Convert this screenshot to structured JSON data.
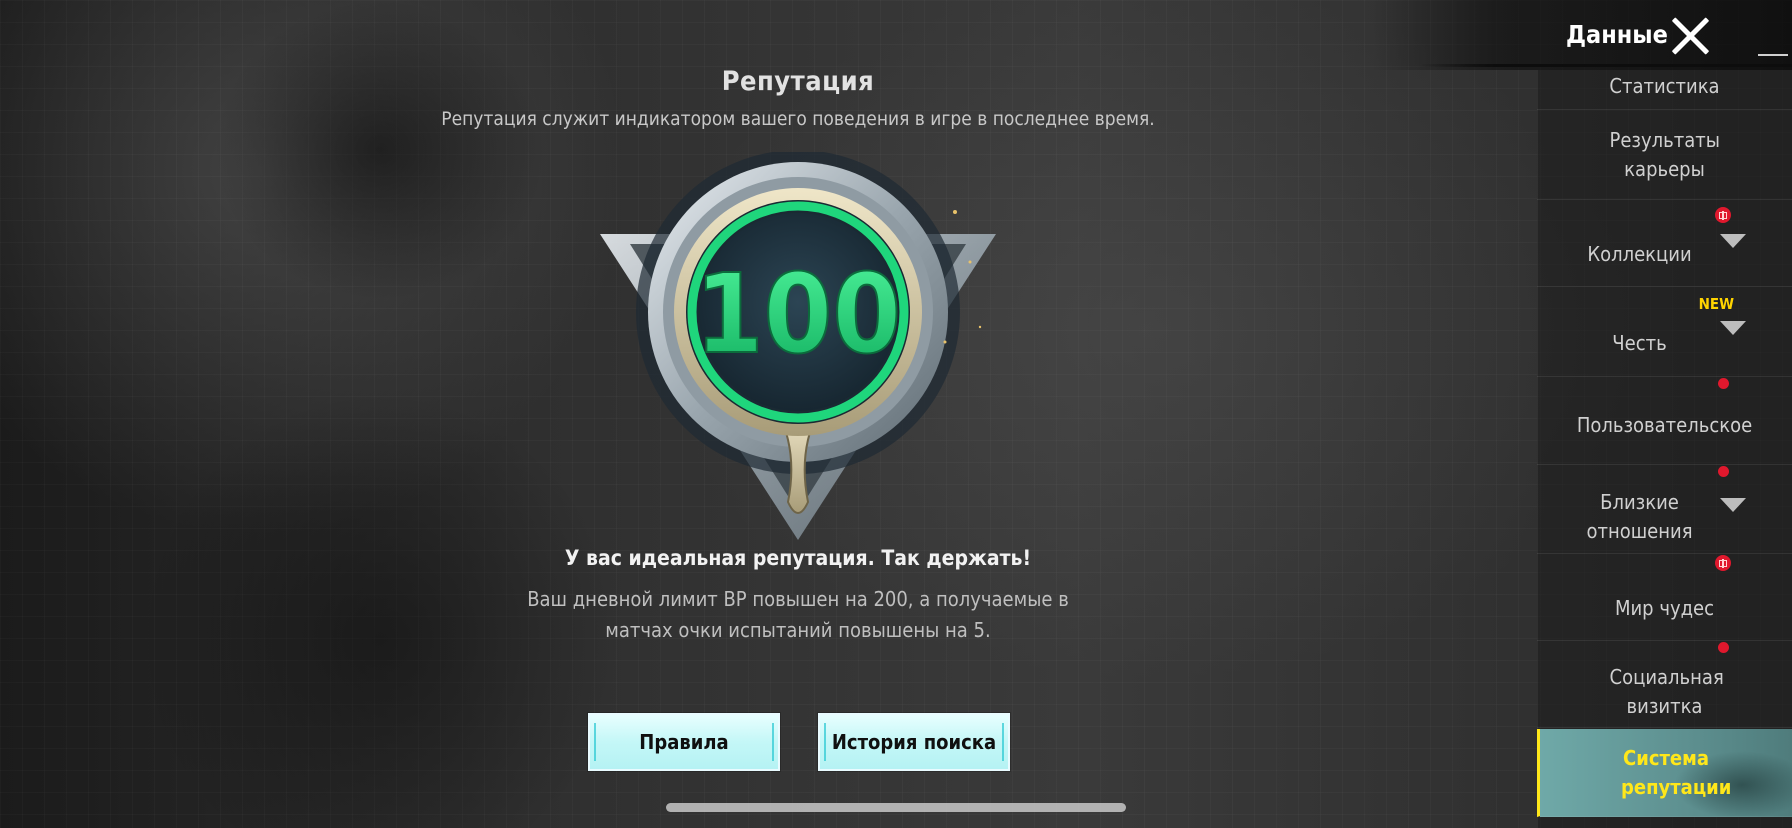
{
  "header": {
    "title": "Данные"
  },
  "main": {
    "title": "Репутация",
    "subtitle": "Репутация служит индикатором вашего поведения в игре в последнее время.",
    "score": "100",
    "status_main": "У вас идеальная репутация. Так держать!",
    "status_desc": "Ваш дневной лимит BP повышен на 200, а получаемые в матчах очки испытаний повышены на 5.",
    "buttons": {
      "rules": "Правила",
      "history": "История поиска"
    }
  },
  "sidebar": {
    "items": [
      {
        "label": "Статистика",
        "badge": ""
      },
      {
        "label": "Результаты карьеры",
        "badge": ""
      },
      {
        "label": "Коллекции",
        "badge": "gift",
        "expandable": true
      },
      {
        "label": "Честь",
        "badge": "NEW",
        "expandable": true
      },
      {
        "label": "Пользовательское",
        "badge": "dot"
      },
      {
        "label": "Близкие отношения",
        "badge": "dot",
        "expandable": true
      },
      {
        "label": "Мир чудес",
        "badge": "gift"
      },
      {
        "label": "Социальная визитка",
        "badge": "dot"
      },
      {
        "label": "Система репутации",
        "badge": "",
        "active": true
      }
    ]
  },
  "colors": {
    "accent_active": "#ffe71a",
    "score_green": "#22d07a",
    "button_bg": "#c4f7f7",
    "badge_red": "#e0182d"
  }
}
